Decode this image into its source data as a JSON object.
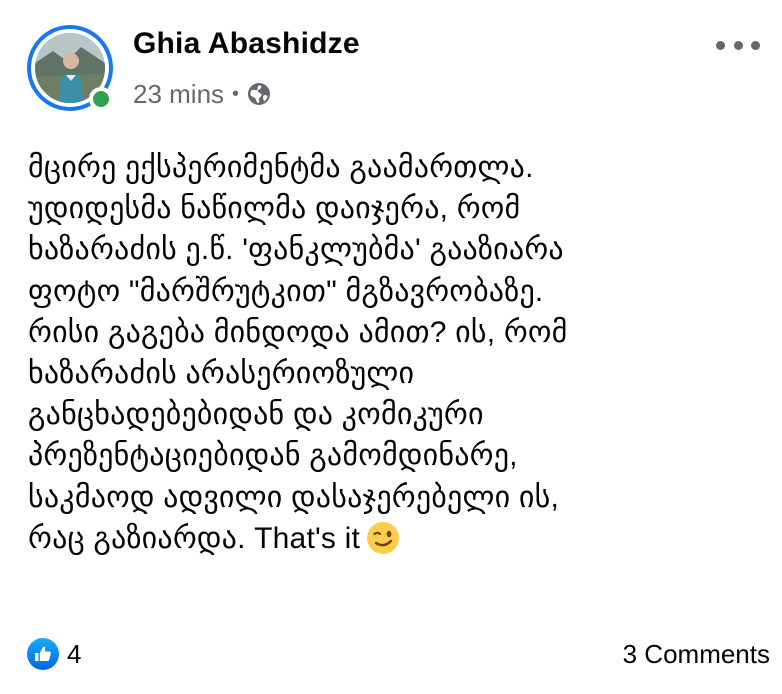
{
  "post": {
    "author": "Ghia Abashidze",
    "timestamp": "23 mins",
    "separator": "•",
    "privacy_icon": "globe-icon",
    "more_icon": "more-horizontal-icon",
    "body_lines": [
      "მცირე ექსპერიმენტმა გაამართლა.",
      "უდიდესმა ნაწილმა დაიჯერა, რომ",
      "ხაზარაძის ე.წ. 'ფანკლუბმა' გააზიარა",
      "ფოტო \"მარშრუტკით\" მგზავრობაზე.",
      "რისი გაგება მინდოდა ამით? ის, რომ",
      "ხაზარაძის არასერიოზული",
      "განცხადებებიდან და კომიკური",
      "პრეზენტაციებიდან გამომდინარე,",
      "საკმაოდ ადვილი დასაჯერებელი ის,",
      "რაც გაზიარდა.  That's it"
    ],
    "emoji": "winking-face-emoji"
  },
  "footer": {
    "reaction_icon": "like-icon",
    "reaction_count": "4",
    "comments": "3 Comments"
  },
  "colors": {
    "accent_blue": "#1877f2",
    "online_green": "#31a24c",
    "meta_gray": "#65676b",
    "text": "#050505"
  }
}
